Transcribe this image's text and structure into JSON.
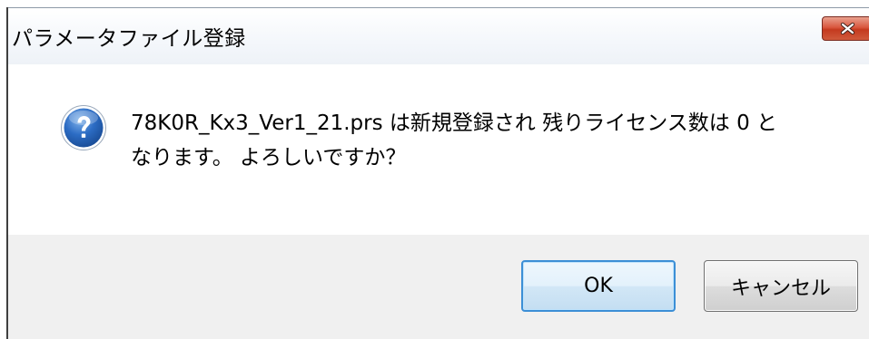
{
  "dialog": {
    "title": "パラメータファイル登録",
    "close_icon": "close-icon",
    "message_icon": "question-icon",
    "message": "78K0R_Kx3_Ver1_21.prs は新規登録され 残りライセンス数は 0 と\nなります。 よろしいですか？",
    "buttons": {
      "ok_label": "OK",
      "cancel_label": "キャンセル"
    }
  },
  "colors": {
    "close_button": "#c43a1f",
    "ok_border": "#3c8fd6",
    "footer_bg": "#f0f0f0",
    "icon_blue": "#1f5fb0"
  }
}
